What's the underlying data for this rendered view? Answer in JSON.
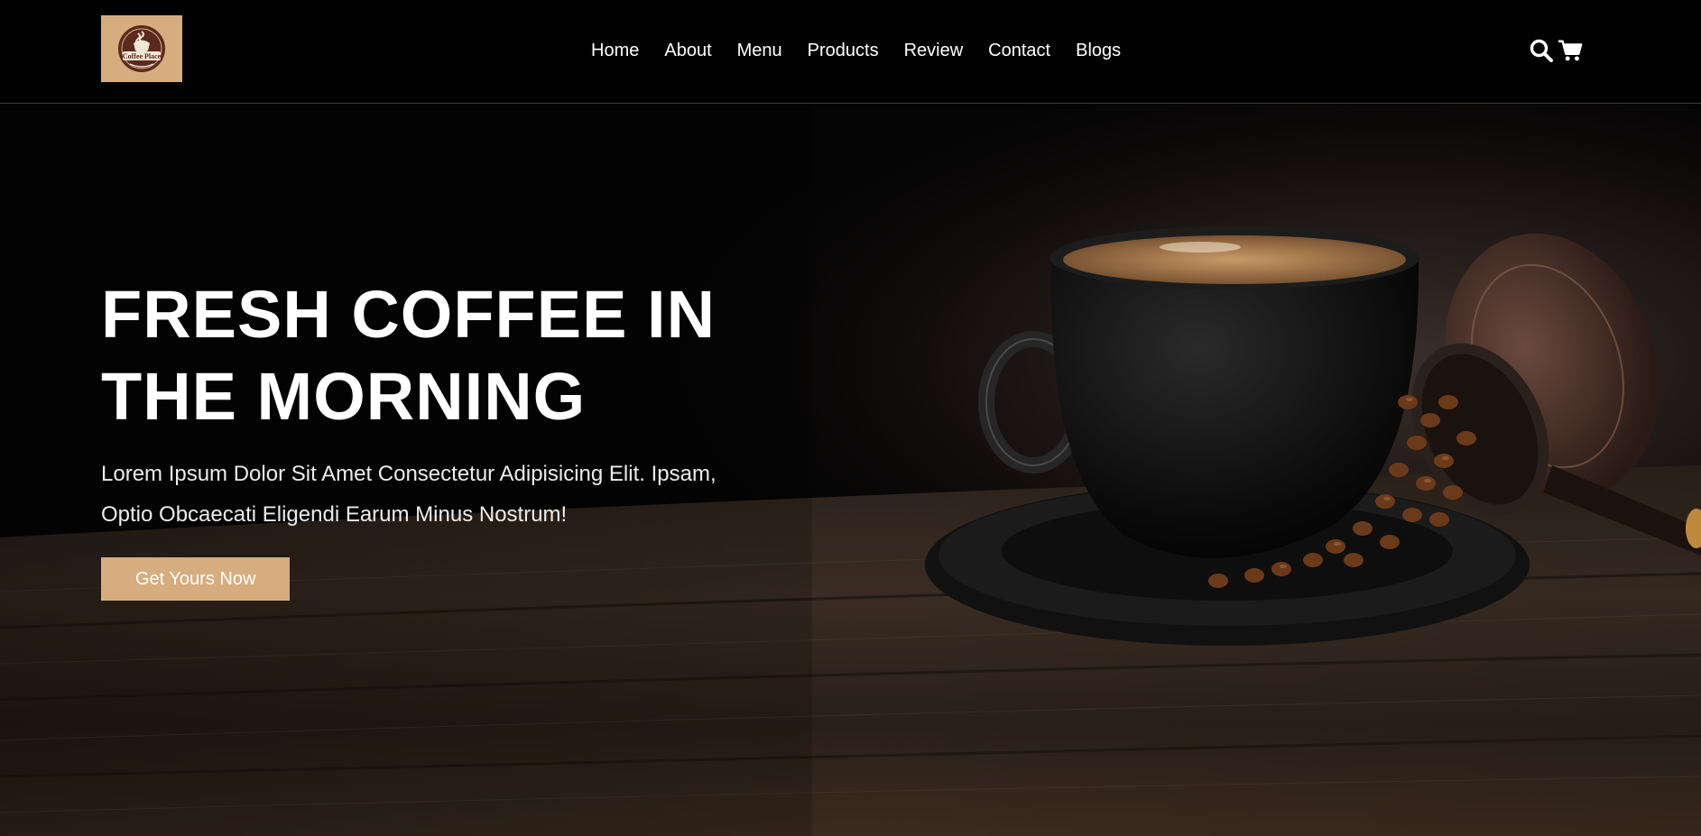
{
  "brand": {
    "logo_text": "Coffee Place",
    "accent_color": "#d6ad7f"
  },
  "nav": {
    "items": [
      {
        "label": "Home"
      },
      {
        "label": "About"
      },
      {
        "label": "Menu"
      },
      {
        "label": "Products"
      },
      {
        "label": "Review"
      },
      {
        "label": "Contact"
      },
      {
        "label": "Blogs"
      }
    ]
  },
  "header_icons": {
    "search": "search-icon",
    "cart": "cart-icon"
  },
  "hero": {
    "title": "FRESH COFFEE IN THE MORNING",
    "text": "Lorem Ipsum Dolor Sit Amet Consectetur Adipisicing Elit. Ipsam, Optio Obcaecati Eligendi Earum Minus Nostrum!",
    "cta_label": "Get Yours Now",
    "image": "coffee-cup-with-beans"
  }
}
